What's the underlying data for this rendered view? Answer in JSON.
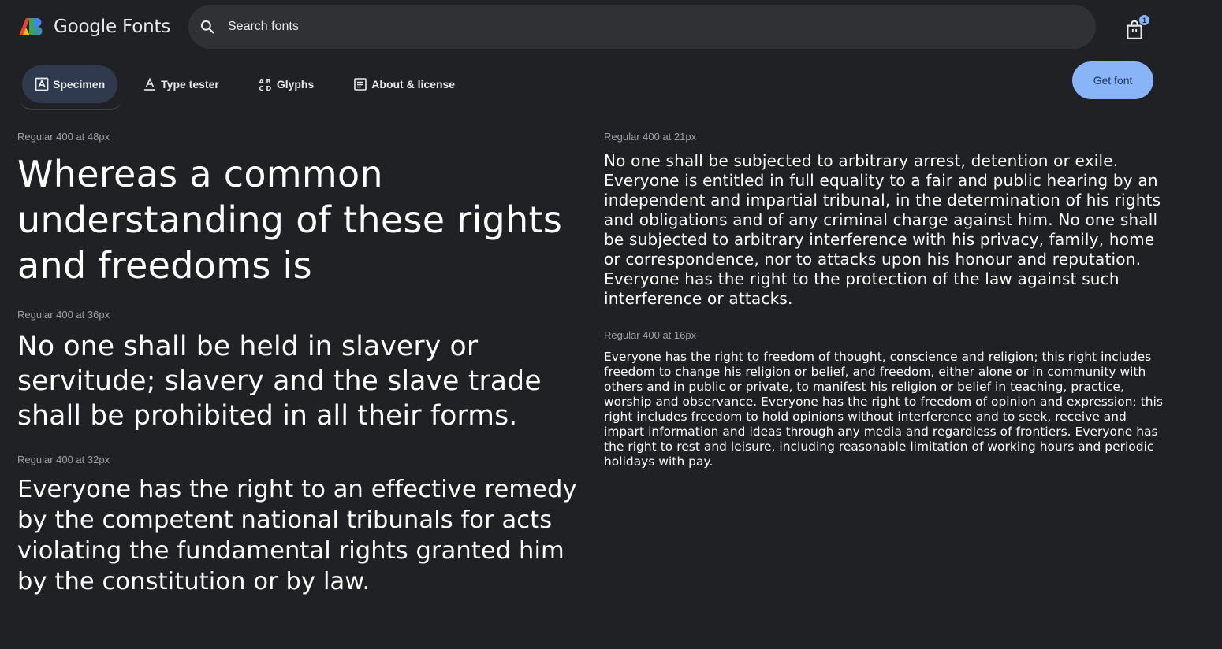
{
  "header": {
    "logo_text": "Google Fonts",
    "search_placeholder": "Search fonts",
    "cart_count": "1"
  },
  "tabs": [
    {
      "label": "Specimen",
      "icon": "specimen-icon",
      "active": true
    },
    {
      "label": "Type tester",
      "icon": "type-tester-icon",
      "active": false
    },
    {
      "label": "Glyphs",
      "icon": "glyphs-icon",
      "active": false
    },
    {
      "label": "About & license",
      "icon": "about-icon",
      "active": false
    }
  ],
  "get_font_label": "Get font",
  "samples": {
    "s48": {
      "label": "Regular 400 at 48px",
      "text": "Whereas a common understanding of these rights and freedoms is"
    },
    "s36": {
      "label": "Regular 400 at 36px",
      "text": "No one shall be held in slavery or servitude; slavery and the slave trade shall be prohibited in all their forms."
    },
    "s32": {
      "label": "Regular 400 at 32px",
      "text": "Everyone has the right to an effective remedy by the competent national tribunals for acts violating the fundamental rights granted him by the constitution or by law."
    },
    "s21": {
      "label": "Regular 400 at 21px",
      "text": "No one shall be subjected to arbitrary arrest, detention or exile. Everyone is entitled in full equality to a fair and public hearing by an independent and impartial tribunal, in the determination of his rights and obligations and of any criminal charge against him. No one shall be subjected to arbitrary interference with his privacy, family, home or correspondence, nor to attacks upon his honour and reputation. Everyone has the right to the protection of the law against such interference or attacks."
    },
    "s16": {
      "label": "Regular 400 at 16px",
      "text": "Everyone has the right to freedom of thought, conscience and religion; this right includes freedom to change his religion or belief, and freedom, either alone or in community with others and in public or private, to manifest his religion or belief in teaching, practice, worship and observance. Everyone has the right to freedom of opinion and expression; this right includes freedom to hold opinions without interference and to seek, receive and impart information and ideas through any media and regardless of frontiers. Everyone has the right to rest and leisure, including reasonable limitation of working hours and periodic holidays with pay."
    }
  },
  "colors": {
    "background": "#202124",
    "search_bg": "#303134",
    "active_tab_bg": "#2f3a4e",
    "accent": "#8ab4f8",
    "label_grey": "#9aa0a6"
  }
}
